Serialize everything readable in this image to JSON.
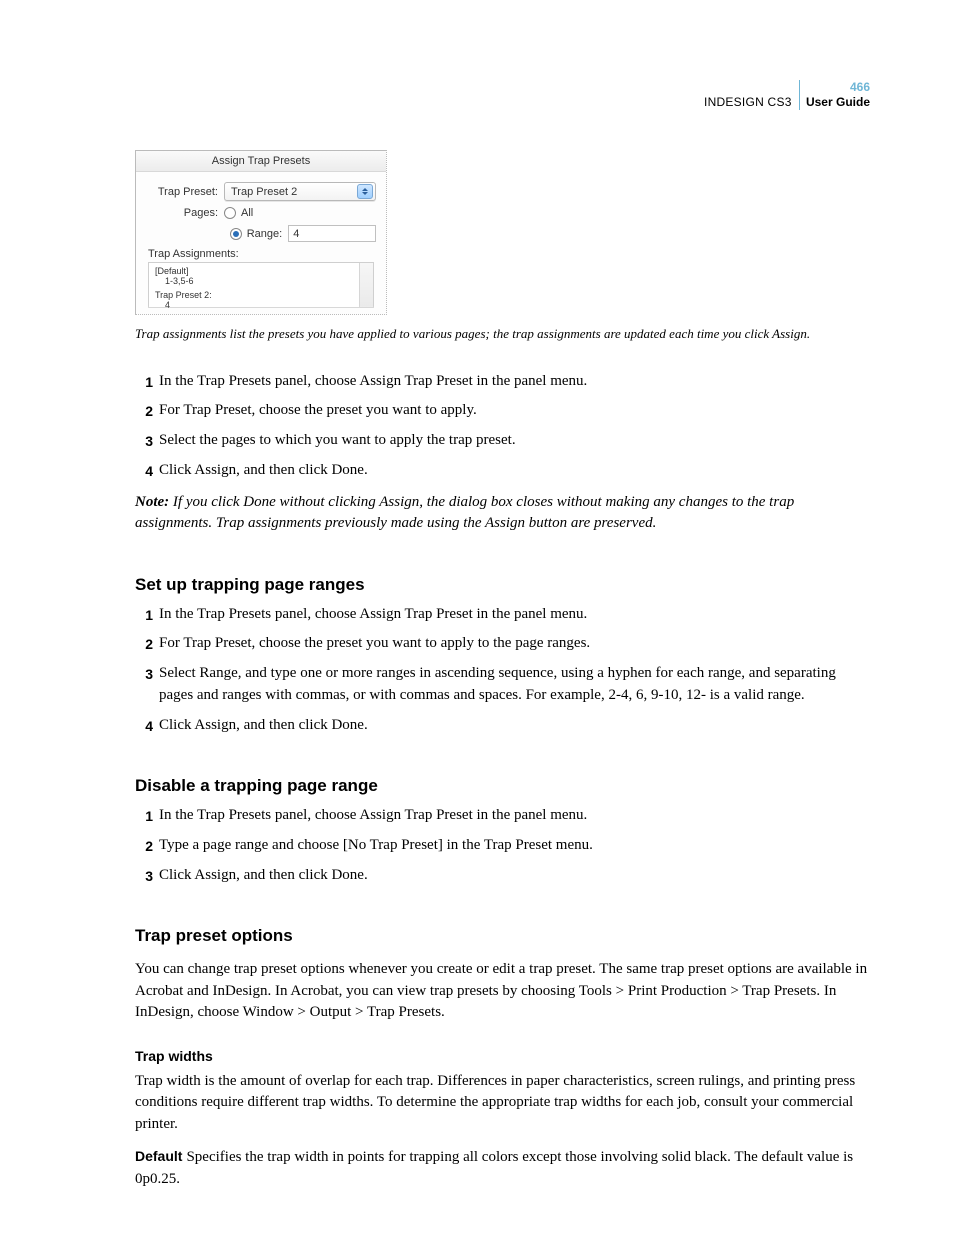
{
  "header": {
    "product": "INDESIGN CS3",
    "page_number": "466",
    "subtitle": "User Guide"
  },
  "dialog": {
    "title": "Assign Trap Presets",
    "preset_label": "Trap Preset:",
    "preset_value": "Trap Preset 2",
    "pages_label": "Pages:",
    "all_label": "All",
    "range_label": "Range:",
    "range_value": "4",
    "assignments_label": "Trap Assignments:",
    "assignments": [
      {
        "name": "[Default]",
        "pages": "1-3,5-6"
      },
      {
        "name": "Trap Preset 2:",
        "pages": "4"
      }
    ]
  },
  "caption": "Trap assignments list the presets you have applied to various pages; the trap assignments are updated each time you click Assign.",
  "list1": [
    "In the Trap Presets panel, choose Assign Trap Preset in the panel menu.",
    "For Trap Preset, choose the preset you want to apply.",
    "Select the pages to which you want to apply the trap preset.",
    "Click Assign, and then click Done."
  ],
  "note_label": "Note:",
  "note": " If you click Done without clicking Assign, the dialog box closes without making any changes to the trap assignments. Trap assignments previously made using the Assign button are preserved.",
  "h2a": "Set up trapping page ranges",
  "list2": [
    "In the Trap Presets panel, choose Assign Trap Preset in the panel menu.",
    "For Trap Preset, choose the preset you want to apply to the page ranges.",
    "Select Range, and type one or more ranges in ascending sequence, using a hyphen for each range, and separating pages and ranges with commas, or with commas and spaces. For example, 2-4, 6, 9-10, 12- is a valid range.",
    "Click Assign, and then click Done."
  ],
  "h2b": "Disable a trapping page range",
  "list3": [
    "In the Trap Presets panel, choose Assign Trap Preset in the panel menu.",
    "Type a page range and choose [No Trap Preset] in the Trap Preset menu.",
    "Click Assign, and then click Done."
  ],
  "h2c": "Trap preset options",
  "options_intro": "You can change trap preset options whenever you create or edit a trap preset. The same trap preset options are available in Acrobat and InDesign. In Acrobat, you can view trap presets by choosing Tools > Print Production > Trap Presets. In InDesign, choose Window > Output > Trap Presets.",
  "h3a": "Trap widths",
  "trap_widths_p": "Trap width is the amount of overlap for each trap. Differences in paper characteristics, screen rulings, and printing press conditions require different trap widths. To determine the appropriate trap widths for each job, consult your commercial printer.",
  "default_label": "Default",
  "default_p": "Specifies the trap width in points for trapping all colors except those involving solid black. The default value is 0p0.25."
}
